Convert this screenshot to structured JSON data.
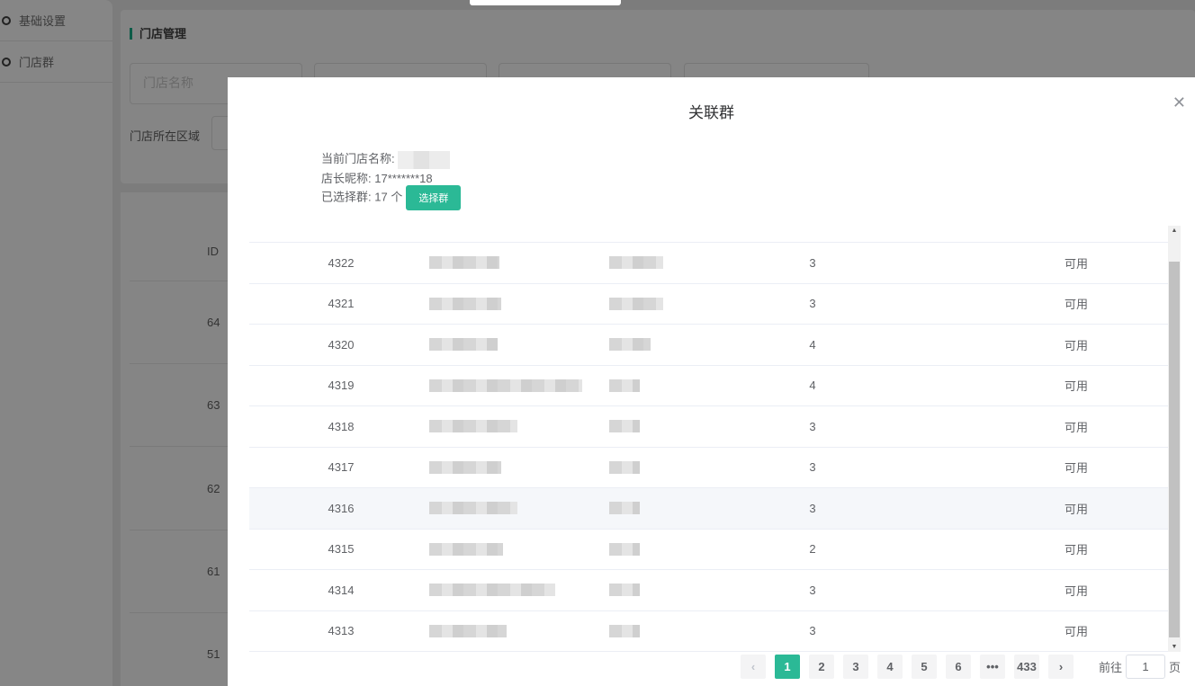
{
  "sidebar": {
    "items": [
      {
        "label": "基础设置"
      },
      {
        "label": "门店群"
      }
    ]
  },
  "background": {
    "title": "门店管理",
    "input_placeholder": "门店名称",
    "region_label": "门店所在区域",
    "id_header": "ID",
    "ids": [
      "64",
      "63",
      "62",
      "61",
      "51"
    ]
  },
  "modal": {
    "title": "关联群",
    "close_icon": "close-icon",
    "store_name_label": "当前门店名称:",
    "owner_label": "店长昵称:",
    "owner_value": "17*******18",
    "selected_label": "已选择群:",
    "selected_count": "17 个",
    "select_button": "选择群",
    "rows": [
      {
        "id": "4322",
        "count": "3",
        "status": "可用"
      },
      {
        "id": "4321",
        "count": "3",
        "status": "可用"
      },
      {
        "id": "4320",
        "count": "4",
        "status": "可用"
      },
      {
        "id": "4319",
        "count": "4",
        "status": "可用"
      },
      {
        "id": "4318",
        "count": "3",
        "status": "可用"
      },
      {
        "id": "4317",
        "count": "3",
        "status": "可用"
      },
      {
        "id": "4316",
        "count": "3",
        "status": "可用"
      },
      {
        "id": "4315",
        "count": "2",
        "status": "可用"
      },
      {
        "id": "4314",
        "count": "3",
        "status": "可用"
      },
      {
        "id": "4313",
        "count": "3",
        "status": "可用"
      }
    ],
    "pagination": {
      "pages": [
        "1",
        "2",
        "3",
        "4",
        "5",
        "6",
        "•••",
        "433"
      ],
      "current": "1",
      "goto_prefix": "前往",
      "goto_value": "1",
      "goto_suffix": "页"
    }
  },
  "colors": {
    "accent": "#2bb996"
  }
}
